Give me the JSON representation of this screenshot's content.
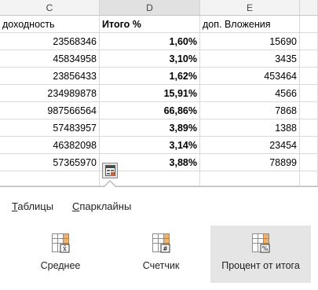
{
  "columns": [
    {
      "letter": "C"
    },
    {
      "letter": "D"
    },
    {
      "letter": "E"
    },
    {
      "letter": ""
    }
  ],
  "rows": [
    {
      "c": "доходность",
      "d": "Итого %",
      "e": "доп. Вложения"
    },
    {
      "c": "23568346",
      "d": "1,60%",
      "e": "15690"
    },
    {
      "c": "45834958",
      "d": "3,10%",
      "e": "3435"
    },
    {
      "c": "23856433",
      "d": "1,62%",
      "e": "453464"
    },
    {
      "c": "234989878",
      "d": "15,91%",
      "e": "4566"
    },
    {
      "c": "987566564",
      "d": "66,86%",
      "e": "7868"
    },
    {
      "c": "57483957",
      "d": "3,89%",
      "e": "1388"
    },
    {
      "c": "46382098",
      "d": "3,14%",
      "e": "23454"
    },
    {
      "c": "57365970",
      "d": "3,88%",
      "e": "78899"
    }
  ],
  "quick_analysis": {
    "icon": "quick-analysis-icon",
    "tabs": [
      {
        "hotkey": "Т",
        "rest": "аблицы"
      },
      {
        "hotkey": "С",
        "rest": "парклайны"
      }
    ],
    "options": [
      {
        "label": "Среднее",
        "icon": "average-icon",
        "symbol": "x̄"
      },
      {
        "label": "Счетчик",
        "icon": "count-icon",
        "symbol": "#"
      },
      {
        "label": "Процент от итога",
        "icon": "percent-total-icon",
        "symbol": "%",
        "selected": true
      }
    ]
  },
  "colors": {
    "accent": "#217346",
    "selected_bg": "#e5e5e5",
    "icon_orange": "#f0b16a"
  }
}
